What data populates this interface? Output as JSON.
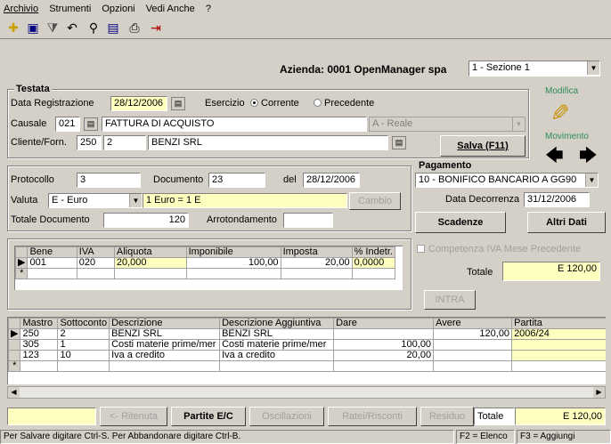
{
  "menu": [
    "Archivio",
    "Strumenti",
    "Opzioni",
    "Vedi Anche",
    "?"
  ],
  "toolbar_icons": [
    "new-icon",
    "save-icon",
    "filter-icon",
    "undo-icon",
    "find-icon",
    "preview-icon",
    "print-icon",
    "exit-icon"
  ],
  "header": {
    "azienda": "Azienda: 0001 OpenManager spa",
    "sezione": "1 - Sezione 1",
    "modifica": "Modifica",
    "movimento": "Movimento"
  },
  "testata": {
    "title": "Testata",
    "data_reg_label": "Data Registrazione",
    "data_reg": "28/12/2006",
    "esercizio_label": "Esercizio",
    "corrente": "Corrente",
    "precedente": "Precedente",
    "causale_label": "Causale",
    "causale_code": "021",
    "causale_desc": "FATTURA DI ACQUISTO",
    "causale_type": "A - Reale",
    "cliente_label": "Cliente/Forn.",
    "cliente_code": "250",
    "cliente_sub": "2",
    "cliente_name": "BENZI SRL",
    "salva": "Salva (F11)"
  },
  "doc": {
    "protocollo_label": "Protocollo",
    "protocollo": "3",
    "documento_label": "Documento",
    "documento": "23",
    "del_label": "del",
    "del": "28/12/2006",
    "valuta_label": "Valuta",
    "valuta": "E - Euro",
    "cambio_desc": "1 Euro = 1 E",
    "cambio_btn": "Cambio",
    "totale_label": "Totale Documento",
    "totale": "120",
    "arrotondamento_label": "Arrotondamento"
  },
  "pagamento": {
    "title": "Pagamento",
    "value": "10 - BONIFICO BANCARIO A GG90",
    "decorrenza_label": "Data Decorrenza",
    "decorrenza": "31/12/2006",
    "scadenze": "Scadenze",
    "altri_dati": "Altri Dati"
  },
  "iva": {
    "headers": [
      "Bene",
      "IVA",
      "Aliquota",
      "Imponibile",
      "Imposta",
      "% Indetr."
    ],
    "rows": [
      [
        "001",
        "020",
        "20,000",
        "100,00",
        "20,00",
        "0,0000"
      ]
    ],
    "competenza": "Competenza IVA Mese Precedente",
    "totale_label": "Totale",
    "totale": "E 120,00",
    "intra": "INTRA"
  },
  "mov": {
    "headers": [
      "Mastro",
      "Sottoconto",
      "Descrizione",
      "Descrizione Aggiuntiva",
      "Dare",
      "Avere",
      "Partita"
    ],
    "rows": [
      [
        "250",
        "2",
        "BENZI SRL",
        "BENZI SRL",
        "",
        "120,00",
        "2006/24"
      ],
      [
        "305",
        "1",
        "Costi materie prime/mer",
        "Costi materie prime/mer",
        "100,00",
        "",
        ""
      ],
      [
        "123",
        "10",
        "Iva a credito",
        "Iva a credito",
        "20,00",
        "",
        ""
      ]
    ]
  },
  "bottom": {
    "ritenuta": "<- Ritenuta",
    "partite": "Partite E/C",
    "oscillazioni": "Oscillazioni",
    "ratei": "Ratei/Risconti",
    "residuo": "Residuo",
    "totale_label": "Totale",
    "totale": "E 120,00"
  },
  "status": {
    "hint": "Per Salvare digitare Ctrl-S.  Per Abbandonare digitare Ctrl-B.",
    "f2": "F2 = Elenco",
    "f3": "F3 = Aggiungi"
  },
  "colors": {
    "window_bg": "#d4d0c8",
    "highlight_yellow": "#ffffc0",
    "accent_green": "#2e8b57"
  }
}
